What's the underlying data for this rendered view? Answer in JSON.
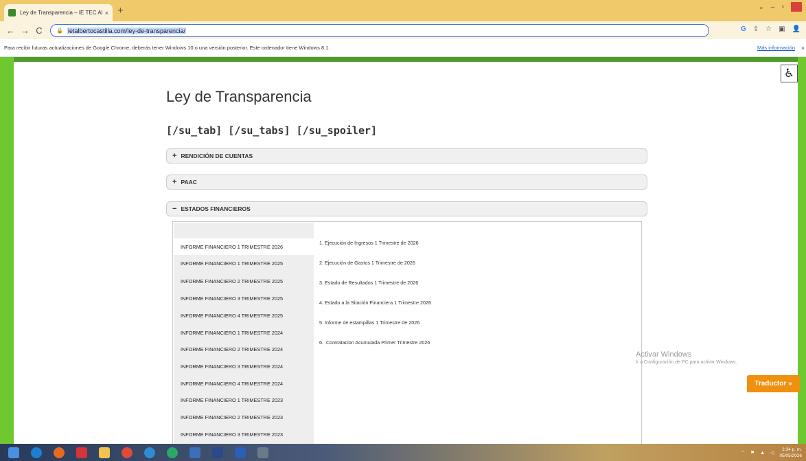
{
  "browser": {
    "tab_title": "Ley de Transparencia – IE TEC Al...",
    "tab_close": "×",
    "new_tab": "+",
    "url": "ietalbertocastilla.com/ley-de-transparencia/",
    "nav_back": "←",
    "nav_forward": "→",
    "nav_reload": "C",
    "lock": "🔒",
    "toolbar_icons": [
      "G",
      "⇪",
      "☆",
      "▣",
      "👤"
    ],
    "window_controls": [
      "⌄",
      "–",
      "▫"
    ]
  },
  "infobar": {
    "message": "Para recibir futuras actualizaciones de Google Chrome, deberás tener Windows 10 o una versión posterior. Este ordenador tiene Windows 8.1.",
    "link": "Más información",
    "close": "×"
  },
  "page": {
    "title": "Ley de Transparencia",
    "shortcodes": "[/su_tab] [/su_tabs] [/su_spoiler]",
    "accessibility_icon": "♿",
    "spoilers": [
      {
        "sign": "+",
        "label": "RENDICIÓN DE CUENTAS"
      },
      {
        "sign": "+",
        "label": "PAAC"
      },
      {
        "sign": "−",
        "label": "ESTADOS FINANCIEROS"
      }
    ],
    "vtabs": [
      "INFORME FINANCIERO 1 TRIMESTRE 2026",
      "INFORME FINANCIERO 1 TRIMESTRE 2025",
      "INFORME FINANCIERO 2 TRIMESTRE 2025",
      "INFORME FINANCIERO 3 TRIMESTRE 2025",
      "INFORME FINANCIERO 4 TRIMESTRE 2025",
      "INFORME FINANCIERO 1 TRIMESTRE 2024",
      "INFORME FINANCIERO 2 TRIMESTRE 2024",
      "INFORME FINANCIERO 3 TRIMESTRE 2024",
      "INFORME FINANCIERO 4 TRIMESTRE 2024",
      "INFORME FINANCIERO 1 TRIMESTRE 2023",
      "INFORME FINANCIERO 2 TRIMESTRE 2023",
      "INFORME FINANCIERO 3 TRIMESTRE 2023"
    ],
    "active_tab": 0,
    "documents": [
      "1. Ejecución de Ingresos 1 Trimestre de 2026",
      "2. Ejecución de Gastos 1 Trimestre de 2026",
      "3. Estado de Resultados 1 Trimestre de 2026",
      "4. Estado a la Sitación Financiera 1 Trimestre 2026",
      "5. Informe de estampillas 1 Trimestre de 2026",
      "6. .Contratacion Acumulada Primer Trimestre 2026"
    ],
    "translator_button": "Traductor »"
  },
  "watermark": {
    "line1": "Activar Windows",
    "line2": "Ir a Configuración de PC para activar Windows."
  },
  "taskbar": {
    "clock_time": "2:34 p. m.",
    "clock_date": "05/05/2026"
  },
  "colors": {
    "site_green": "#6fc830",
    "chrome_tab_strip": "#f0c96a",
    "translator_orange": "#f0900f"
  }
}
